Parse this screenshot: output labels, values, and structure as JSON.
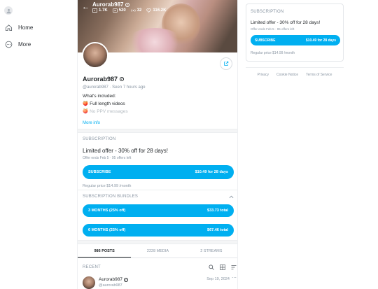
{
  "nav": {
    "items": [
      {
        "label": "Home",
        "icon": "home-icon"
      },
      {
        "label": "More",
        "icon": "more-icon"
      }
    ]
  },
  "profile": {
    "name": "Aurorab987",
    "handle": "@aurorab987",
    "seen": "Seen 7 hours ago",
    "stats": {
      "photos": "1.7K",
      "videos": "520",
      "streams": "32",
      "likes": "116.2K"
    },
    "included_title": "What's included:",
    "included": [
      {
        "emoji": "🍑",
        "label": "Full length videos"
      },
      {
        "emoji": "🍑",
        "label": "No PPV messages"
      }
    ],
    "more_info": "More info"
  },
  "subscription": {
    "label": "SUBSCRIPTION",
    "offer_title": "Limited offer - 30% off for 28 days!",
    "offer_sub": "Offer ends Feb 5",
    "offers_left": "95 offers left",
    "button_label": "SUBSCRIBE",
    "button_price": "$10.49 for 28 days",
    "regular_price": "Regular price $14.99 /month"
  },
  "bundles": {
    "label": "SUBSCRIPTION BUNDLES",
    "items": [
      {
        "label": "3 MONTHS (25% off)",
        "price": "$33.73 total"
      },
      {
        "label": "6 MONTHS (25% off)",
        "price": "$67.46 total"
      }
    ]
  },
  "tabs": [
    {
      "label": "986 POSTS",
      "active": true
    },
    {
      "label": "2228 MEDIA",
      "active": false
    },
    {
      "label": "2 STREAMS",
      "active": false
    }
  ],
  "recent": {
    "label": "RECENT",
    "post": {
      "name": "Aurorab987",
      "handle": "@aurorab987",
      "date": "Sep 19, 2024"
    }
  },
  "footer": {
    "links": [
      "Privacy",
      "Cookie Notice",
      "Terms of Service"
    ]
  },
  "colors": {
    "accent": "#00aff0",
    "muted": "#8a96a3"
  }
}
